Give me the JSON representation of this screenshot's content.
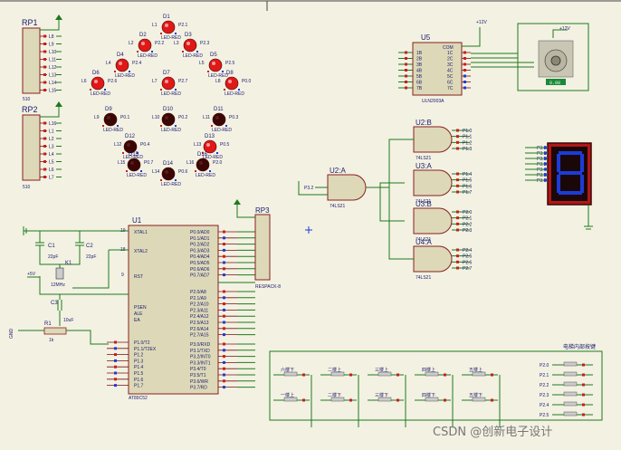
{
  "watermark": "CSDN @创新电子设计",
  "colors": {
    "led_on": "#e01818",
    "led_off": "#3a0606",
    "seg_on": "#1c3cd8",
    "seg_bg": "#b01818",
    "wire": "#1d7a1d",
    "body": "#ddd9b8",
    "outline": "#8a2020"
  },
  "rp1": {
    "name": "RP1",
    "value": "510",
    "pins": [
      "L8",
      "L9",
      "L10",
      "L11",
      "L12",
      "L13",
      "L14",
      "L15"
    ]
  },
  "rp2": {
    "name": "RP2",
    "value": "510",
    "pins": [
      "L16",
      "L1",
      "L2",
      "L3",
      "L4",
      "L5",
      "L6",
      "L7"
    ]
  },
  "leds": [
    {
      "ref": "D1",
      "label": "L1",
      "on": true,
      "model": "LED-RED",
      "pin": "P2.1"
    },
    {
      "ref": "D2",
      "label": "L2",
      "on": true,
      "model": "LED-RED",
      "pin": "P2.2"
    },
    {
      "ref": "D3",
      "label": "L3",
      "on": true,
      "model": "LED-RED",
      "pin": "P2.3"
    },
    {
      "ref": "D4",
      "label": "L4",
      "on": true,
      "model": "LED-RED",
      "pin": "P2.4"
    },
    {
      "ref": "D5",
      "label": "L5",
      "on": true,
      "model": "LED-RED",
      "pin": "P2.5"
    },
    {
      "ref": "D6",
      "label": "L6",
      "on": true,
      "model": "LED-RED",
      "pin": "P2.6"
    },
    {
      "ref": "D7",
      "label": "L7",
      "on": true,
      "model": "LED-RED",
      "pin": "P2.7"
    },
    {
      "ref": "D8",
      "label": "L8",
      "on": true,
      "model": "LED-RED",
      "pin": "P0.0"
    },
    {
      "ref": "D9",
      "label": "L9",
      "on": false,
      "model": "LED-RED",
      "pin": "P0.1"
    },
    {
      "ref": "D10",
      "label": "L10",
      "on": false,
      "model": "LED-RED",
      "pin": "P0.2"
    },
    {
      "ref": "D11",
      "label": "L11",
      "on": false,
      "model": "LED-RED",
      "pin": "P0.3"
    },
    {
      "ref": "D12",
      "label": "L12",
      "on": false,
      "model": "LED-RED",
      "pin": "P0.4"
    },
    {
      "ref": "D13",
      "label": "L13",
      "on": true,
      "model": "LED-RED",
      "pin": "P0.5"
    },
    {
      "ref": "D14",
      "label": "L14",
      "on": false,
      "model": "LED-RED",
      "pin": "P0.6"
    },
    {
      "ref": "D15",
      "label": "L15",
      "on": false,
      "model": "LED-RED",
      "pin": "P0.7"
    },
    {
      "ref": "D16",
      "label": "L16",
      "on": false,
      "model": "LED-RED",
      "pin": "P2.0"
    }
  ],
  "u5": {
    "ref": "U5",
    "part": "ULN2003A",
    "com": "COM",
    "left": [
      "1B",
      "2B",
      "3B",
      "4B",
      "5B",
      "6B",
      "7B"
    ],
    "right": [
      "1C",
      "2C",
      "3C",
      "4C",
      "5C",
      "6C",
      "7C"
    ],
    "supply": "+12V"
  },
  "motor": {
    "supply": "+12V",
    "speed": "0.00"
  },
  "gates": [
    {
      "ref": "U2:A",
      "part": "74LS21",
      "inputs": [
        "P3.2"
      ]
    },
    {
      "ref": "U2:B",
      "part": "74LS21",
      "inputs": [
        "P1.0",
        "P1.1",
        "P1.2",
        "P1.3"
      ]
    },
    {
      "ref": "U3:A",
      "part": "74LS21",
      "inputs": [
        "P1.4",
        "P1.5",
        "P1.6",
        "P1.7"
      ]
    },
    {
      "ref": "U3:B",
      "part": "74LS21",
      "inputs": [
        "P2.0",
        "P2.1",
        "P2.2",
        "P2.3"
      ]
    },
    {
      "ref": "U4:A",
      "part": "74LS21",
      "inputs": [
        "P2.4",
        "P2.5",
        "P2.6",
        "P2.7"
      ]
    }
  ],
  "seg": {
    "pins": [
      "P3.0",
      "P3.1",
      "P3.2",
      "P3.3",
      "P3.4",
      "P3.5",
      "P3.6"
    ],
    "digit": "8"
  },
  "mcu": {
    "ref": "U1",
    "part": "AT89C52",
    "xtal": [
      "XTAL1",
      "XTAL2"
    ],
    "rst": "RST",
    "ctrl": [
      "PSEN",
      "ALE",
      "EA"
    ],
    "port0": [
      "P0.0/AD0",
      "P0.1/AD1",
      "P0.2/AD2",
      "P0.3/AD3",
      "P0.4/AD4",
      "P0.5/AD5",
      "P0.6/AD6",
      "P0.7/AD7"
    ],
    "port2": [
      "P2.0/A8",
      "P2.1/A9",
      "P2.2/A10",
      "P2.3/A11",
      "P2.4/A12",
      "P2.5/A13",
      "P2.6/A14",
      "P2.7/A15"
    ],
    "port1": [
      "P1.0/T2",
      "P1.1/T2EX",
      "P1.2",
      "P1.3",
      "P1.4",
      "P1.5",
      "P1.6",
      "P1.7"
    ],
    "port3": [
      "P3.0/RXD",
      "P3.1/TXD",
      "P3.2/INT0",
      "P3.3/INT1",
      "P3.4/T0",
      "P3.5/T1",
      "P3.6/WR",
      "P3.7/RD"
    ],
    "pin_xtal1": "19",
    "pin_xtal2": "18",
    "pin_rst": "9"
  },
  "rp3": {
    "name": "RP3",
    "value": "RESPACK-8"
  },
  "caps": [
    {
      "ref": "C1",
      "value": "22pF"
    },
    {
      "ref": "C2",
      "value": "22pF"
    },
    {
      "ref": "C3",
      "value": "10uF"
    }
  ],
  "crystal": {
    "ref": "K1",
    "value": "12MHz"
  },
  "resistor": {
    "ref": "R1",
    "value": "1k"
  },
  "power": {
    "vcc": "+5V",
    "gnd": "GND"
  },
  "buttons": {
    "row1": [
      "六楼下",
      "二楼上",
      "三楼上",
      "四楼上",
      "五楼上"
    ],
    "row2": [
      "一楼上",
      "二楼下",
      "三楼下",
      "四楼下",
      "五楼下"
    ],
    "inner_title": "电梯内部按键",
    "inner_pins": [
      "P2.0",
      "P2.1",
      "P2.2",
      "P2.3",
      "P2.4",
      "P2.5"
    ]
  }
}
